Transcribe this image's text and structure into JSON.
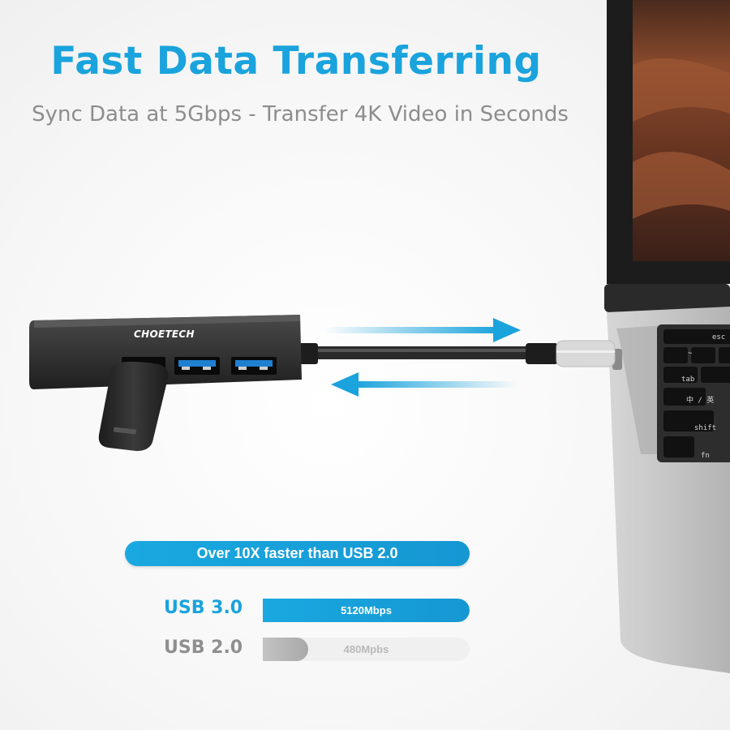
{
  "hero": {
    "title": "Fast Data Transferring",
    "subtitle": "Sync Data at 5Gbps - Transfer 4K Video in Seconds"
  },
  "product": {
    "brand": "CHOETECH"
  },
  "keyboard": {
    "keys": [
      "esc",
      "~",
      "tab",
      "中 / 英",
      "shift",
      "fn"
    ]
  },
  "comparison": {
    "banner": "Over 10X faster than USB 2.0",
    "rows": [
      {
        "label": "USB 3.0",
        "value": "5120Mbps",
        "speed_mbps": 5120,
        "fill_fraction": 1.0
      },
      {
        "label": "USB 2.0",
        "value": "480Mpbs",
        "speed_mbps": 480,
        "fill_fraction": 0.22
      }
    ]
  },
  "colors": {
    "accent": "#1aa3dc",
    "muted": "#8f8f8f"
  }
}
